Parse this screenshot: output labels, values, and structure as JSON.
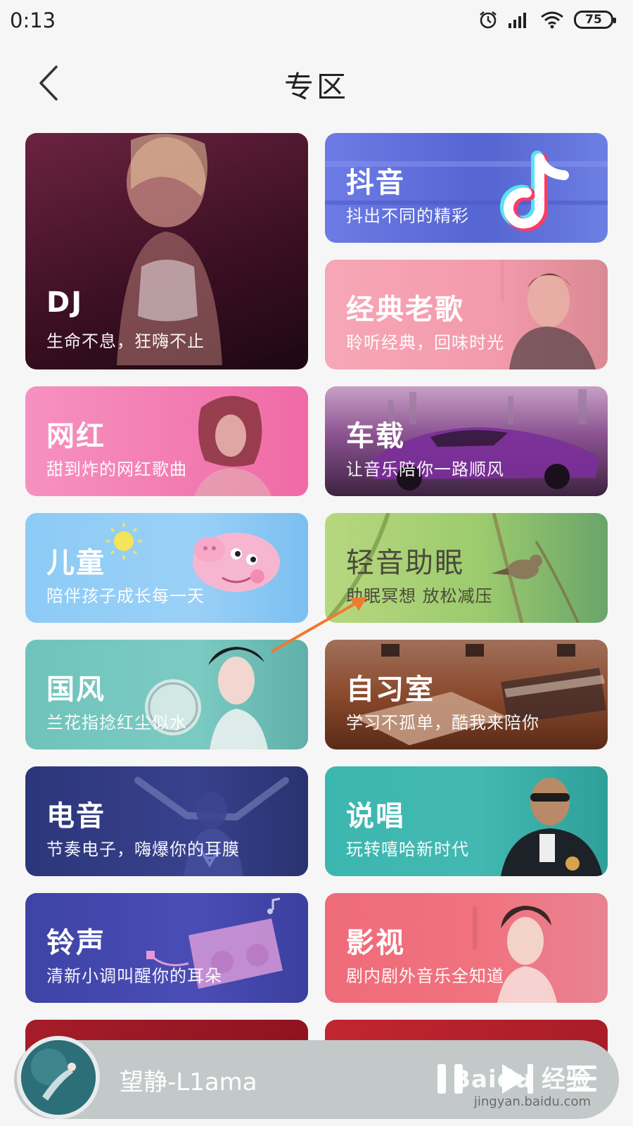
{
  "status_bar": {
    "time": "0:13",
    "battery": "75"
  },
  "header": {
    "title": "专区",
    "back_icon": "chevron-left-icon"
  },
  "cards": [
    {
      "id": "dj",
      "title": "DJ",
      "subtitle": "生命不息，狂嗨不止"
    },
    {
      "id": "douyin",
      "title": "抖音",
      "subtitle": "抖出不同的精彩"
    },
    {
      "id": "classic",
      "title": "经典老歌",
      "subtitle": "聆听经典，回味时光"
    },
    {
      "id": "wanghong",
      "title": "网红",
      "subtitle": "甜到炸的网红歌曲"
    },
    {
      "id": "car",
      "title": "车载",
      "subtitle": "让音乐陪你一路顺风"
    },
    {
      "id": "kids",
      "title": "儿童",
      "subtitle": "陪伴孩子成长每一天"
    },
    {
      "id": "sleep",
      "title": "轻音助眠",
      "subtitle": "助眠冥想 放松减压"
    },
    {
      "id": "guofeng",
      "title": "国风",
      "subtitle": "兰花指捻红尘似水"
    },
    {
      "id": "study",
      "title": "自习室",
      "subtitle": "学习不孤单，酷我来陪你"
    },
    {
      "id": "edm",
      "title": "电音",
      "subtitle": "节奏电子，嗨爆你的耳膜"
    },
    {
      "id": "rap",
      "title": "说唱",
      "subtitle": "玩转嘻哈新时代"
    },
    {
      "id": "ringtone",
      "title": "铃声",
      "subtitle": "清新小调叫醒你的耳朵"
    },
    {
      "id": "film",
      "title": "影视",
      "subtitle": "剧内剧外音乐全知道"
    }
  ],
  "player": {
    "song": "望静-L1ama",
    "state": "playing"
  },
  "watermark": {
    "brand": "Baidu 经验",
    "url": "jingyan.baidu.com"
  },
  "colors": {
    "dj": "#5a1d38",
    "douyin": "#5b6fd6",
    "classic": "#f6a2b4",
    "wanghong": "#f77fb3",
    "car": "#6d3c78",
    "kids": "#8cc8f5",
    "sleep": "#9cc96f",
    "guofeng": "#6fc3bb",
    "study": "#8a4a2e",
    "edm": "#2e3a7a",
    "rap": "#3cb7b0",
    "ringtone": "#3f44a8",
    "film": "#ef6b7a",
    "annotation_arrow": "#f07a2f"
  }
}
